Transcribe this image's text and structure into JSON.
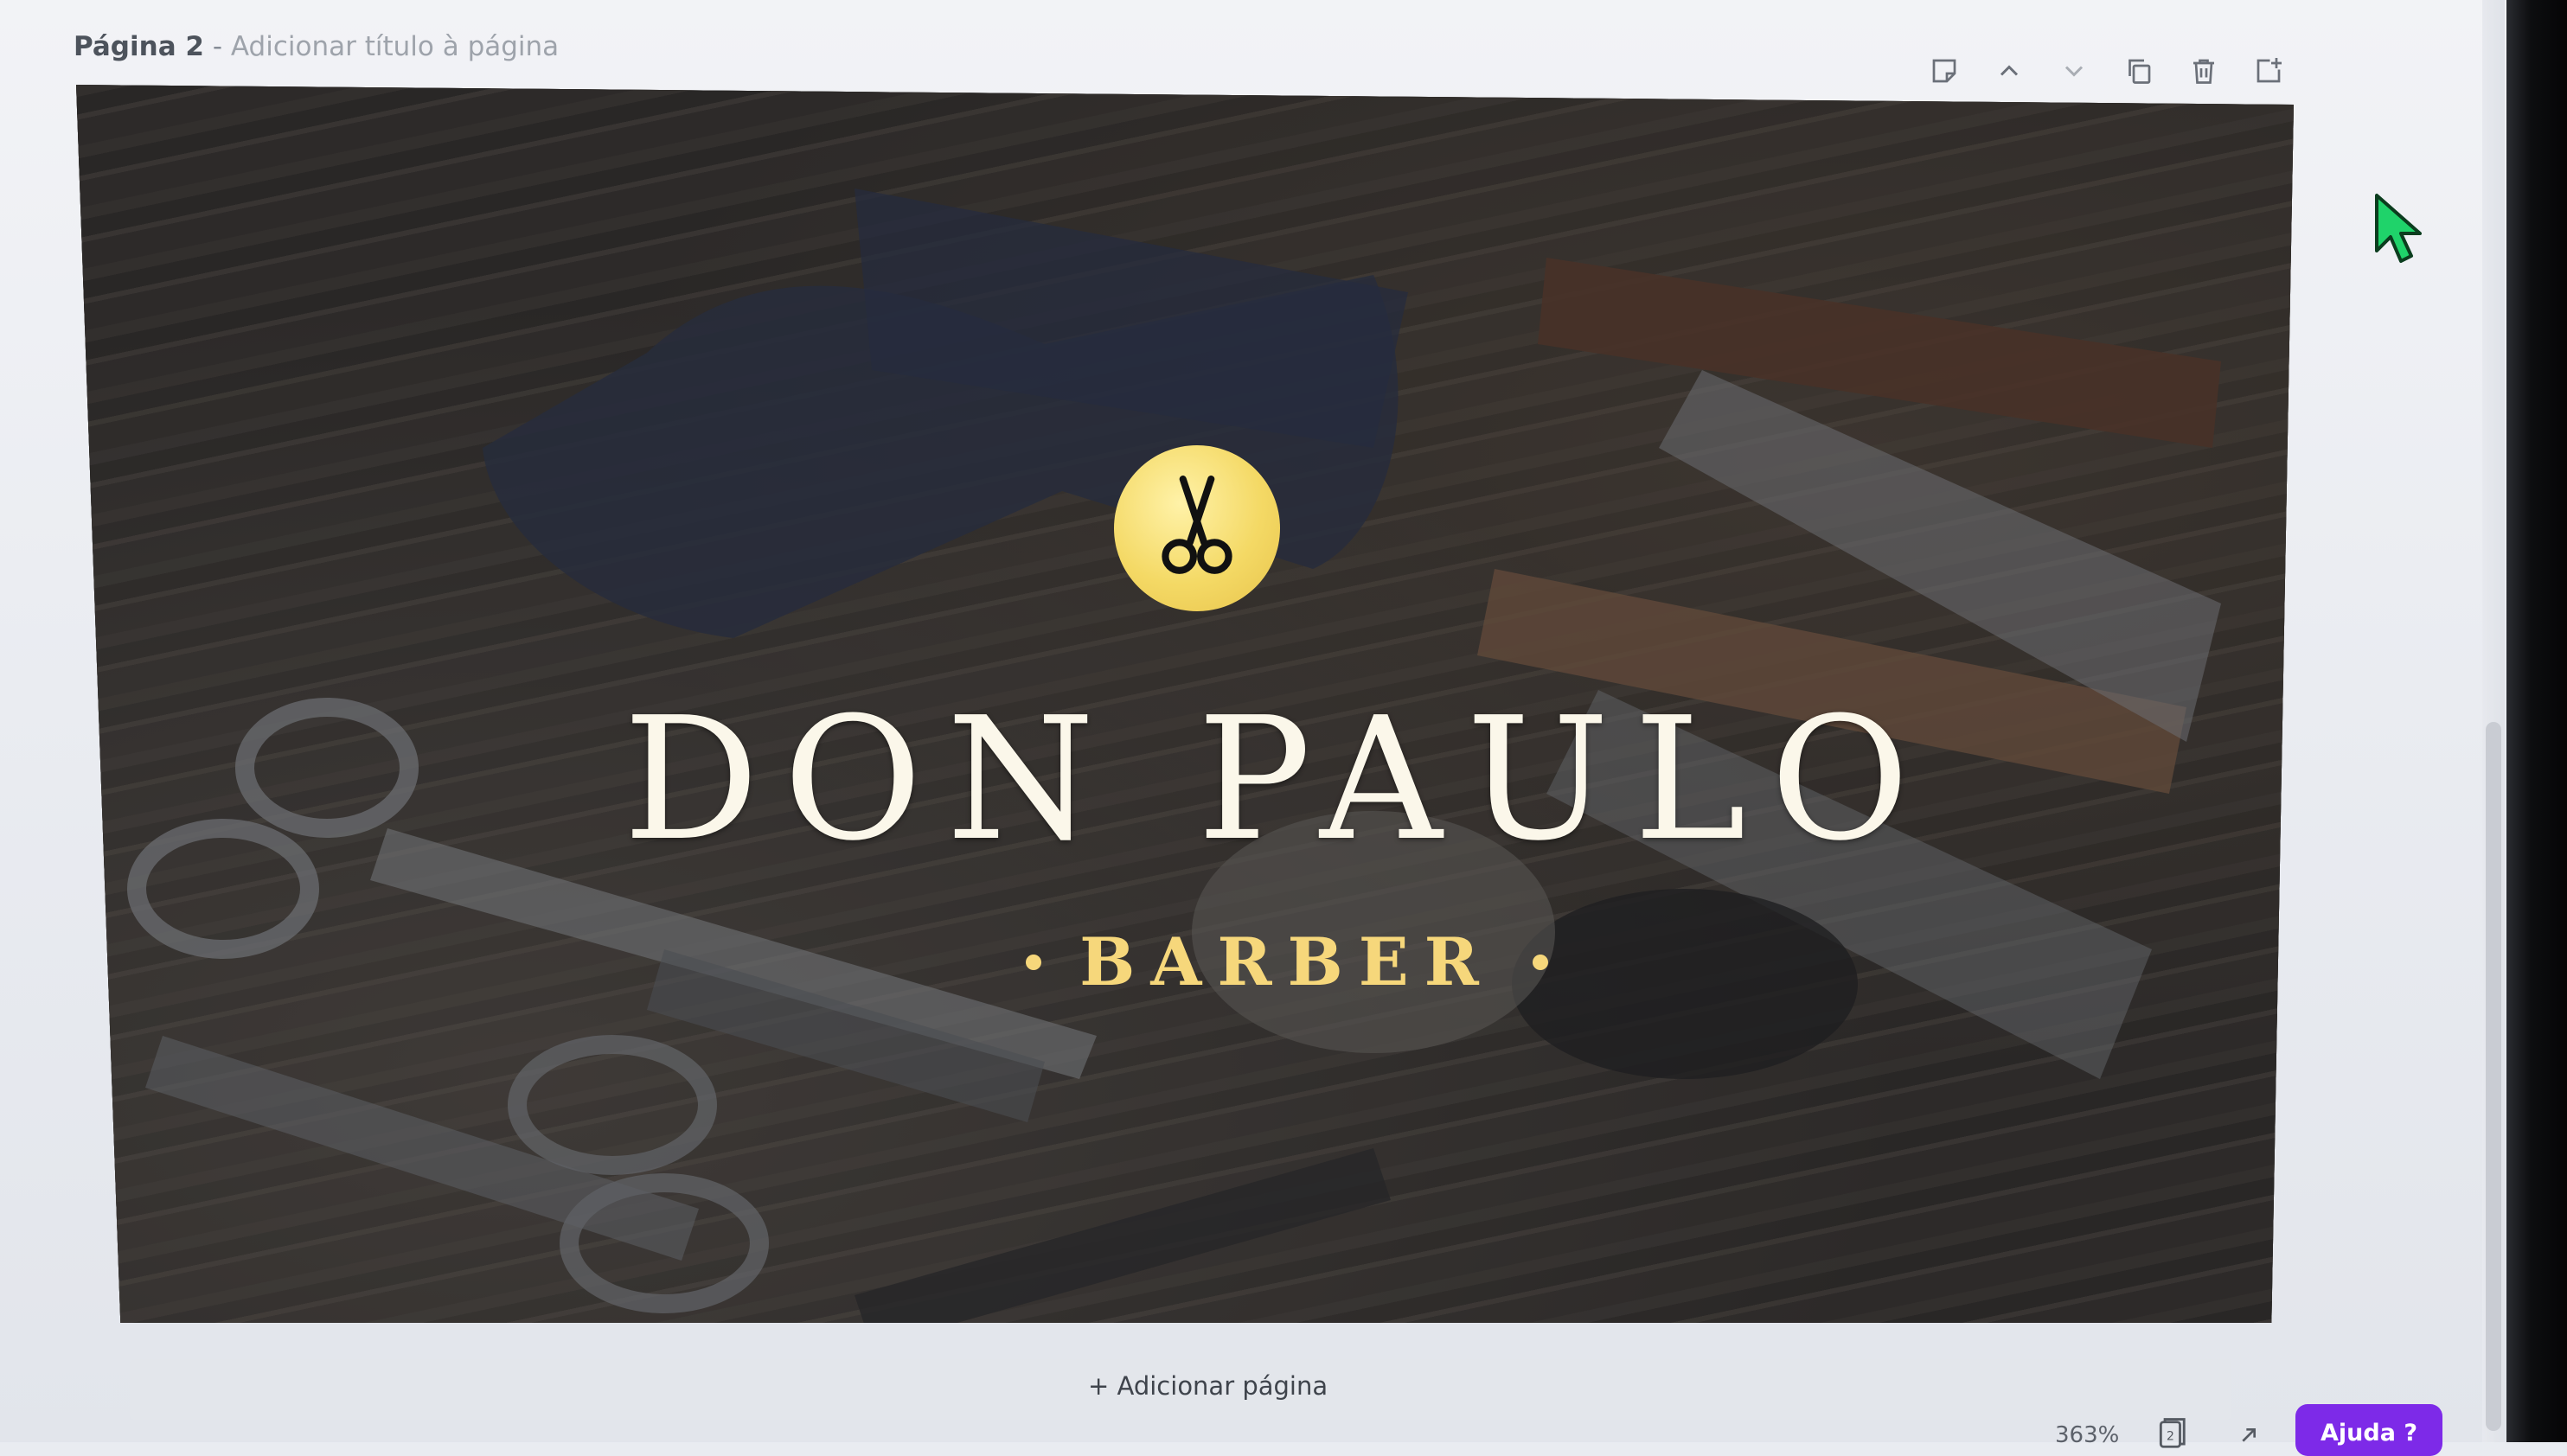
{
  "page": {
    "label": "Página 2",
    "separator": " - ",
    "title_placeholder": "Adicionar título à página"
  },
  "toolbar": {
    "icons": [
      "note-icon",
      "move-up-icon",
      "move-down-icon",
      "duplicate-icon",
      "delete-icon",
      "add-page-icon"
    ]
  },
  "design": {
    "logo_icon": "scissors-icon",
    "brand_name": "DON PAULO",
    "brand_sub": "BARBER",
    "colors": {
      "logo_badge": "#f4d965",
      "brand_name": "#fbf7ea",
      "brand_sub": "#f6d77b"
    }
  },
  "add_page_label": "+ Adicionar página",
  "status": {
    "zoom": "363%",
    "page_count": "2"
  },
  "help": {
    "label": "Ajuda ?",
    "color": "#7d2ae8"
  }
}
